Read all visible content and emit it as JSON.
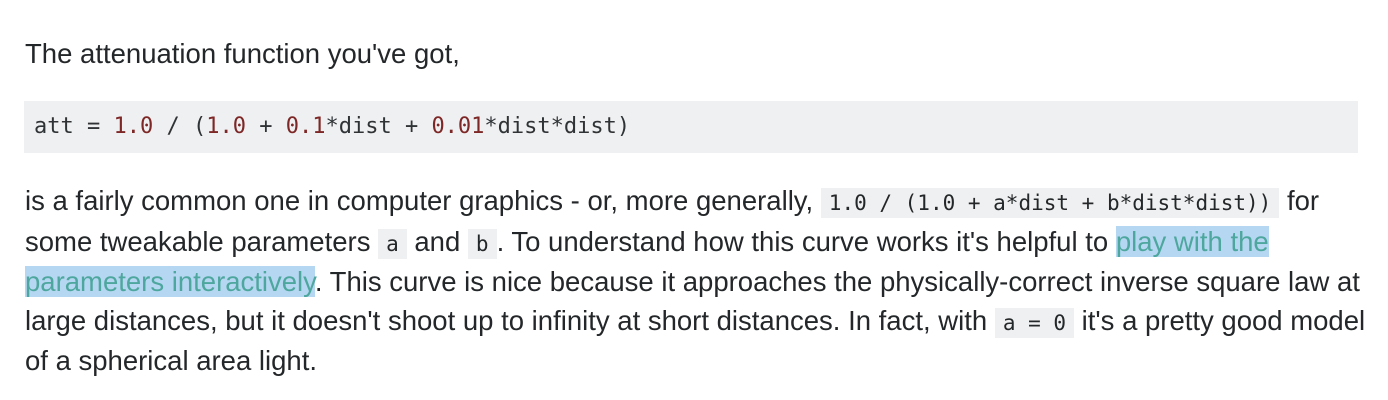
{
  "intro": "The attenuation function you've got,",
  "code_block": {
    "t1": "att = ",
    "n1": "1.0",
    "t2": " / (",
    "n2": "1.0",
    "t3": " + ",
    "n3": "0.1",
    "t4": "*dist + ",
    "n4": "0.01",
    "t5": "*dist*dist)"
  },
  "paragraph": {
    "s1": "is a fairly common one in computer graphics - or, more generally,",
    "code_general": "1.0 / (1.0 + a*dist + b*dist*dist))",
    "s2": "for some tweakable parameters",
    "code_a": "a",
    "s3": "and",
    "code_b": "b",
    "s4": ". To understand how this curve works it's helpful to",
    "link_text": "play with the parameters interactively",
    "s5": ". This curve is nice because it approaches the physically-correct inverse square law at large distances, but it doesn't shoot up to infinity at short distances. In fact, with",
    "code_a0": "a = 0",
    "s6": "it's a pretty good model of a spherical area light."
  }
}
